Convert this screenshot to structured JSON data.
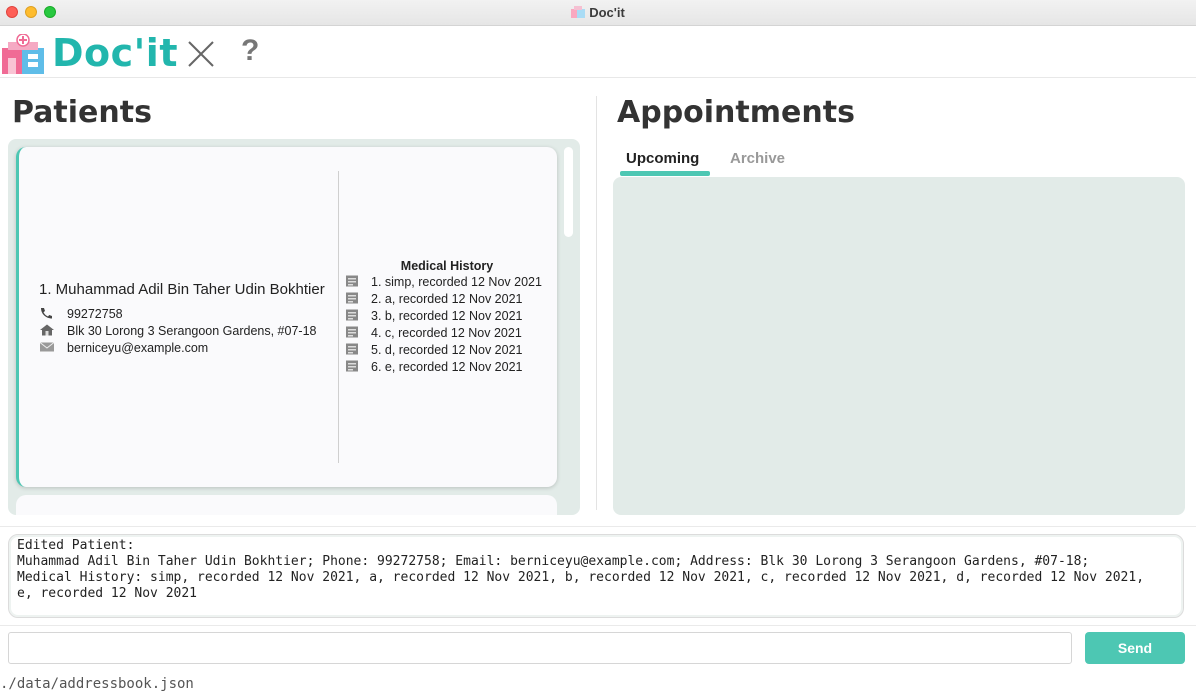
{
  "window": {
    "title": "Doc'it"
  },
  "menubar": {
    "brand": "Doc'it",
    "help_label": "?"
  },
  "patients": {
    "title": "Patients",
    "card": {
      "index_name": "1.  Muhammad Adil Bin Taher Udin Bokhtier",
      "phone": "99272758",
      "address": "Blk 30 Lorong 3 Serangoon Gardens, #07-18",
      "email": "berniceyu@example.com",
      "medical_history_title": "Medical History",
      "medical_history": [
        "1. simp, recorded 12 Nov 2021",
        "2. a, recorded 12 Nov 2021",
        "3. b, recorded 12 Nov 2021",
        "4. c, recorded 12 Nov 2021",
        "5. d, recorded 12 Nov 2021",
        "6. e, recorded 12 Nov 2021"
      ]
    }
  },
  "appointments": {
    "title": "Appointments",
    "tabs": [
      {
        "label": "Upcoming",
        "active": true
      },
      {
        "label": "Archive",
        "active": false
      }
    ]
  },
  "result": {
    "text": "Edited Patient:\nMuhammad Adil Bin Taher Udin Bokhtier; Phone: 99272758; Email: berniceyu@example.com; Address: Blk 30 Lorong 3 Serangoon Gardens, #07-18;\nMedical History: simp, recorded 12 Nov 2021, a, recorded 12 Nov 2021, b, recorded 12 Nov 2021, c, recorded 12 Nov 2021, d, recorded 12 Nov 2021,\ne, recorded 12 Nov 2021"
  },
  "command": {
    "value": "",
    "placeholder": "",
    "send_label": "Send"
  },
  "status": {
    "path": "./data/addressbook.json"
  },
  "colors": {
    "accent": "#4dc7b3",
    "brand": "#22b6ad",
    "panel_bg": "#e2ebe8"
  }
}
